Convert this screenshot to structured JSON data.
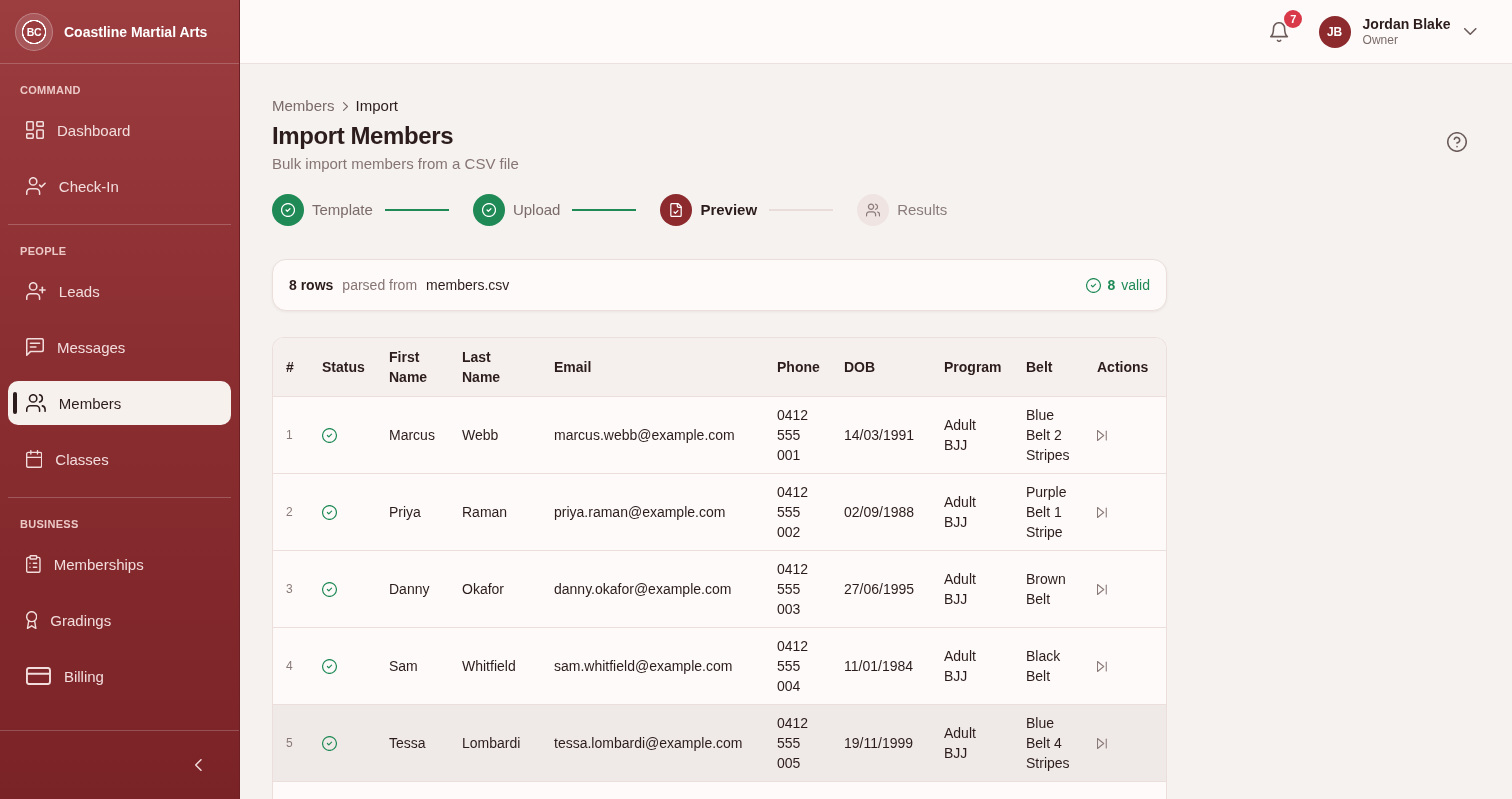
{
  "sidebar": {
    "brand": {
      "logo_text": "BC",
      "name": "Coastline Martial Arts"
    },
    "sections": [
      {
        "label": "COMMAND",
        "items": [
          {
            "label": "Dashboard",
            "selected": false
          },
          {
            "label": "Check-In",
            "selected": false
          }
        ]
      },
      {
        "label": "PEOPLE",
        "items": [
          {
            "label": "Leads",
            "selected": false
          },
          {
            "label": "Messages",
            "selected": false
          },
          {
            "label": "Members",
            "selected": true
          },
          {
            "label": "Classes",
            "selected": false
          }
        ]
      },
      {
        "label": "BUSINESS",
        "items": [
          {
            "label": "Memberships",
            "selected": false
          },
          {
            "label": "Gradings",
            "selected": false
          },
          {
            "label": "Billing",
            "selected": false
          }
        ]
      }
    ]
  },
  "top_bar": {
    "notification_count": "7",
    "user": {
      "initials": "JB",
      "name": "Jordan Blake",
      "role": "Owner"
    }
  },
  "breadcrumb": [
    {
      "label": "Members",
      "current": false
    },
    {
      "label": "Import",
      "current": true
    }
  ],
  "page": {
    "title": "Import Members",
    "subtitle": "Bulk import members from a CSV file"
  },
  "steps": [
    {
      "label": "Template",
      "completed": true,
      "current": false
    },
    {
      "label": "Upload",
      "completed": true,
      "current": false
    },
    {
      "label": "Preview",
      "completed": false,
      "current": true
    },
    {
      "label": "Results",
      "completed": false,
      "current": false
    }
  ],
  "summary": {
    "row_count": "8 rows",
    "source_label": "parsed from",
    "file_name": "members.csv",
    "valid_count": "8",
    "valid_label": "valid"
  },
  "table": {
    "columns": [
      "#",
      "Status",
      "First Name",
      "Last Name",
      "Email",
      "Phone",
      "DOB",
      "Program",
      "Belt",
      "Actions"
    ],
    "rows": [
      {
        "number": "1",
        "valid": true,
        "first_name": "Marcus",
        "last_name": "Webb",
        "email": "marcus.webb@example.com",
        "phone": "0412 555 001",
        "dob": "14/03/1991",
        "program": "Adult BJJ",
        "belt": "Blue Belt 2 Stripes",
        "hovered": false
      },
      {
        "number": "2",
        "valid": true,
        "first_name": "Priya",
        "last_name": "Raman",
        "email": "priya.raman@example.com",
        "phone": "0412 555 002",
        "dob": "02/09/1988",
        "program": "Adult BJJ",
        "belt": "Purple Belt 1 Stripe",
        "hovered": false
      },
      {
        "number": "3",
        "valid": true,
        "first_name": "Danny",
        "last_name": "Okafor",
        "email": "danny.okafor@example.com",
        "phone": "0412 555 003",
        "dob": "27/06/1995",
        "program": "Adult BJJ",
        "belt": "Brown Belt",
        "hovered": false
      },
      {
        "number": "4",
        "valid": true,
        "first_name": "Sam",
        "last_name": "Whitfield",
        "email": "sam.whitfield@example.com",
        "phone": "0412 555 004",
        "dob": "11/01/1984",
        "program": "Adult BJJ",
        "belt": "Black Belt",
        "hovered": false
      },
      {
        "number": "5",
        "valid": true,
        "first_name": "Tessa",
        "last_name": "Lombardi",
        "email": "tessa.lombardi@example.com",
        "phone": "0412 555 005",
        "dob": "19/11/1999",
        "program": "Adult BJJ",
        "belt": "Blue Belt 4 Stripes",
        "hovered": true
      }
    ]
  }
}
